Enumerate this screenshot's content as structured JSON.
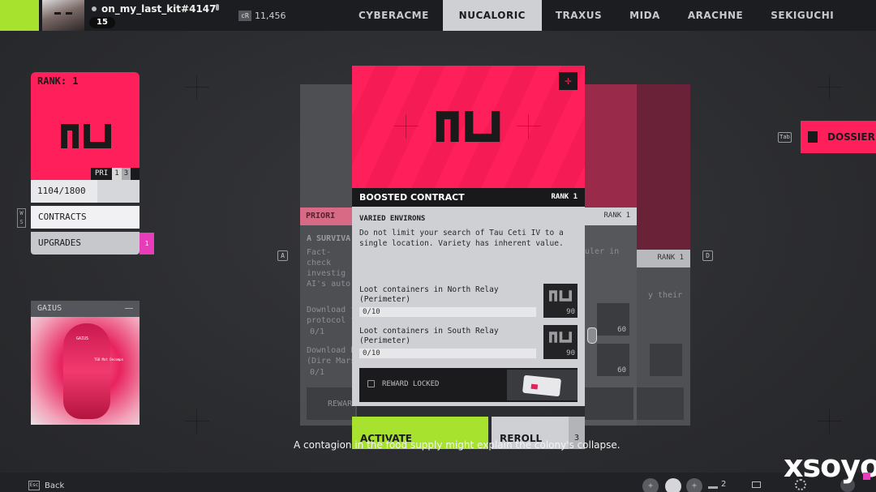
{
  "top_bar": {
    "username": "on_my_last_kit#4147",
    "level": "15",
    "credits_icon_label": "cR",
    "credits": "11,456",
    "tabs": [
      {
        "label": "CYBERACME",
        "active": false
      },
      {
        "label": "NUCALORIC",
        "active": true
      },
      {
        "label": "TRAXUS",
        "active": false
      },
      {
        "label": "MIDA",
        "active": false
      },
      {
        "label": "ARACHNE",
        "active": false
      },
      {
        "label": "SEKIGUCHI",
        "active": false
      }
    ]
  },
  "faction_panel": {
    "rank_label": "RANK: 1",
    "pri_label": "PRI",
    "pri_current": "1",
    "pri_total": "3",
    "progress_text": "1104/1800",
    "progress_fraction": 0.613,
    "menu": [
      {
        "label": "CONTRACTS"
      },
      {
        "label": "UPGRADES",
        "badge": "1"
      }
    ],
    "menu_key_hint": "W S"
  },
  "gaius": {
    "label": "GAIUS",
    "image_labels": [
      "GAIUS",
      "TSB Mat Decomps"
    ]
  },
  "nav_keys": {
    "left": "A",
    "right": "D"
  },
  "back_cards": [
    {
      "header": "PRIORI",
      "title": "A SURVIVA",
      "text": "Fact-check investig AI's auto",
      "objectives": [
        {
          "label": "Download t protocol f",
          "value": "0/1"
        },
        {
          "label": "Download h (Dire Mars",
          "value": "0/1"
        }
      ],
      "reward": "REWAR"
    },
    {
      "header": "RANK 1",
      "text": "uler in",
      "thumbs": [
        "60",
        "60"
      ]
    },
    {
      "header": "RANK 1",
      "text": "y their"
    }
  ],
  "main_card": {
    "title": "BOOSTED CONTRACT",
    "rank": "RANK 1",
    "mission_title": "VARIED ENVIRONS",
    "description": "Do not limit your search of Tau Ceti IV to a single location. Variety has inherent value.",
    "objectives": [
      {
        "label": "Loot containers in North Relay (Perimeter)",
        "progress": "0/10",
        "reward_value": "90"
      },
      {
        "label": "Loot containers in South Relay (Perimeter)",
        "progress": "0/10",
        "reward_value": "90"
      }
    ],
    "reward_text": "REWARD LOCKED"
  },
  "buttons": {
    "activate": "ACTIVATE",
    "reroll": "REROLL",
    "reroll_count": "3"
  },
  "subtitle": "A contagion in the food supply might explain the colony's collapse.",
  "dossier": {
    "label": "DOSSIER",
    "key": "Tab"
  },
  "bottom_bar": {
    "esc_key": "Esc",
    "back_label": "Back",
    "squad_count": "2"
  },
  "watermark": "xsoyo",
  "colors": {
    "accent_pink": "#ff1f5b",
    "accent_lime": "#a6e22e",
    "badge_magenta": "#e83dbb"
  }
}
